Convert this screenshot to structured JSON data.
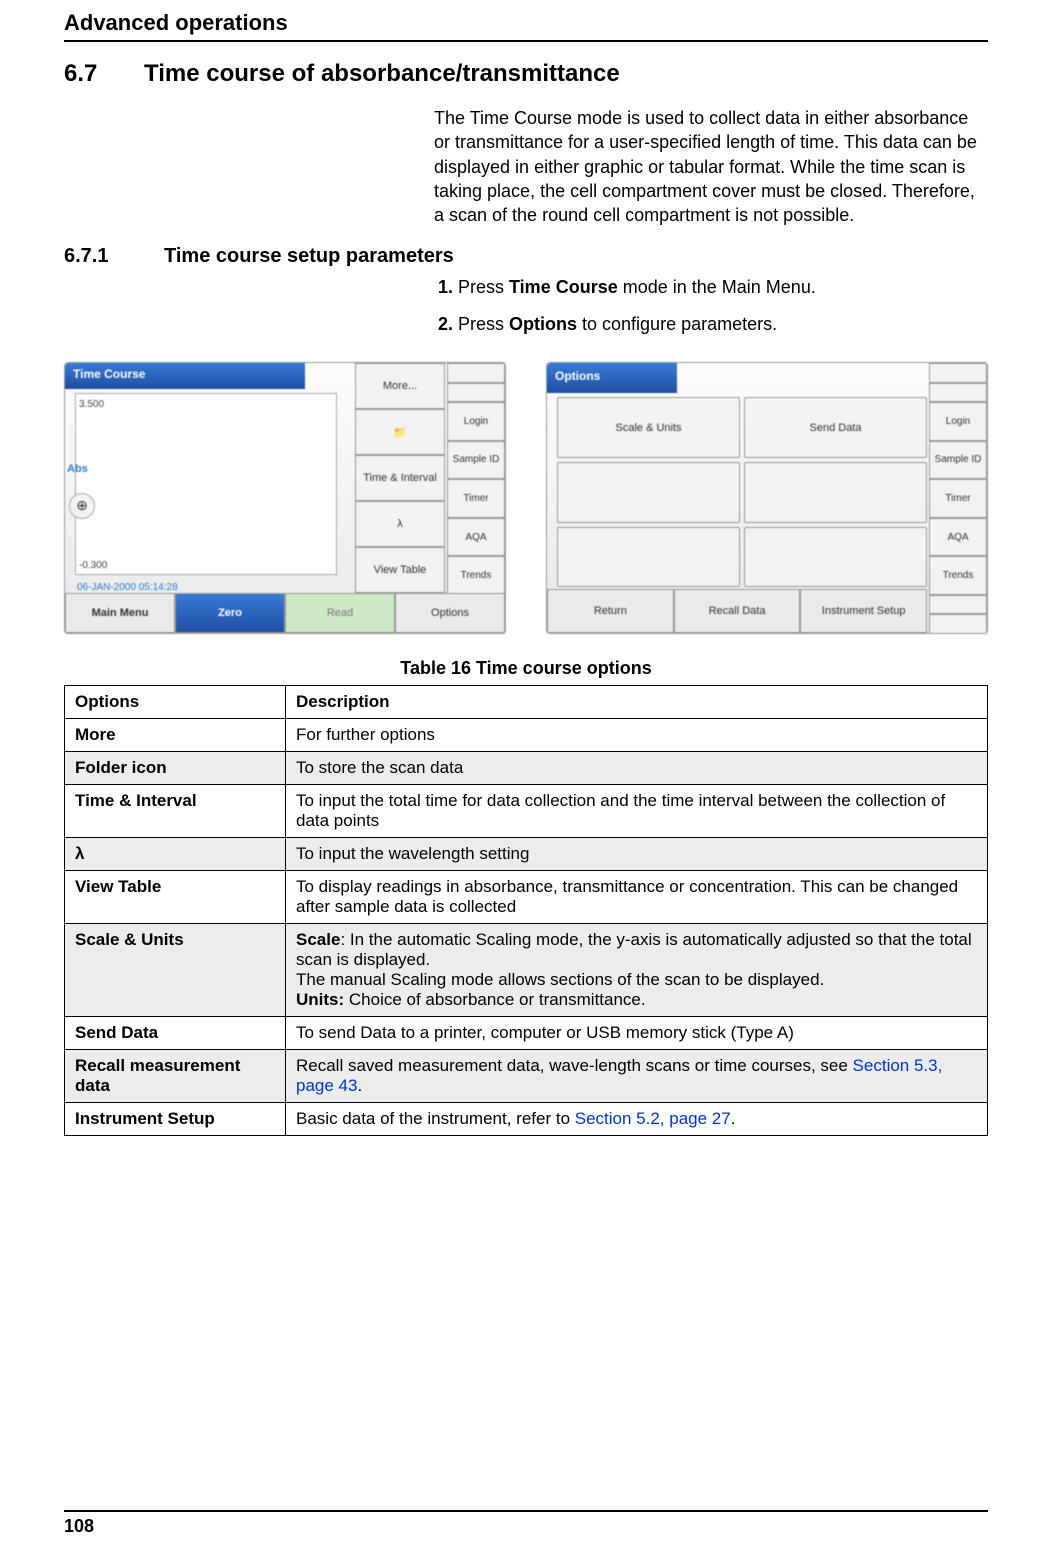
{
  "header": {
    "running": "Advanced operations"
  },
  "section": {
    "num": "6.7",
    "title": "Time course of absorbance/transmittance",
    "body": "The Time Course mode is used to collect data in either absorbance or transmittance for a user-specified length of time. This data can be displayed in either graphic or tabular format. While the time scan is taking place, the cell compartment cover must be closed. Therefore, a scan of the round cell compartment is not possible."
  },
  "subsection": {
    "num": "6.7.1",
    "title": "Time course setup parameters",
    "steps": [
      {
        "pre": "Press ",
        "bold": "Time Course",
        "post": " mode in the Main Menu."
      },
      {
        "pre": "Press ",
        "bold": "Options",
        "post": " to configure parameters."
      }
    ]
  },
  "screenshot1": {
    "title": "Time Course",
    "ymax": "3.500",
    "ymin": "-0.300",
    "abs_label": "Abs",
    "zoom": "⊕",
    "date": "06-JAN-2000  05:14:28",
    "right_buttons": [
      "More...",
      "📁",
      "Time & Interval",
      "λ",
      "View Table"
    ],
    "bottom": {
      "main": "Main Menu",
      "zero": "Zero",
      "read": "Read",
      "options": "Options"
    },
    "sidebar": [
      "",
      "Login",
      "Sample ID",
      "Timer",
      "AQA",
      "Trends",
      ""
    ]
  },
  "screenshot2": {
    "title": "Options",
    "grid": [
      "Scale & Units",
      "Send Data",
      "",
      "",
      "",
      ""
    ],
    "bottom": [
      "Return",
      "Recall Data",
      "Instrument Setup"
    ],
    "sidebar": [
      "",
      "Login",
      "Sample ID",
      "Timer",
      "AQA",
      "Trends",
      ""
    ]
  },
  "table": {
    "caption": "Table 16 Time course options",
    "head": {
      "c1": "Options",
      "c2": "Description"
    },
    "rows": [
      {
        "opt": "More",
        "desc": "For further options"
      },
      {
        "opt": "Folder icon",
        "desc": "To store the scan data"
      },
      {
        "opt": "Time & Interval",
        "desc": "To input the total time for data collection and the time interval between the collection of data points"
      },
      {
        "opt": "λ",
        "desc": "To input the wavelength setting"
      },
      {
        "opt": "View Table",
        "desc": "To display readings in absorbance, transmittance or concentration. This can be changed after sample data is collected"
      },
      {
        "opt": "Scale & Units",
        "scale_bold": "Scale",
        "scale_text1": ": In the automatic Scaling mode, the y-axis is automatically adjusted so that the total scan is displayed.",
        "scale_text2": "The manual Scaling mode allows sections of the scan to be displayed.",
        "units_bold": "Units:",
        "units_text": " Choice of absorbance or transmittance."
      },
      {
        "opt": "Send Data",
        "desc": "To send Data to a printer, computer or USB memory stick (Type A)"
      },
      {
        "opt": "Recall measurement data",
        "desc_pre": "Recall saved measurement data, wave-length scans or time courses, see ",
        "link": "Section 5.3, page 43",
        "desc_post": "."
      },
      {
        "opt": "Instrument Setup",
        "desc_pre": "Basic data of the instrument, refer to ",
        "link": "Section 5.2, page 27",
        "desc_post": "."
      }
    ]
  },
  "footer": {
    "page": "108"
  }
}
